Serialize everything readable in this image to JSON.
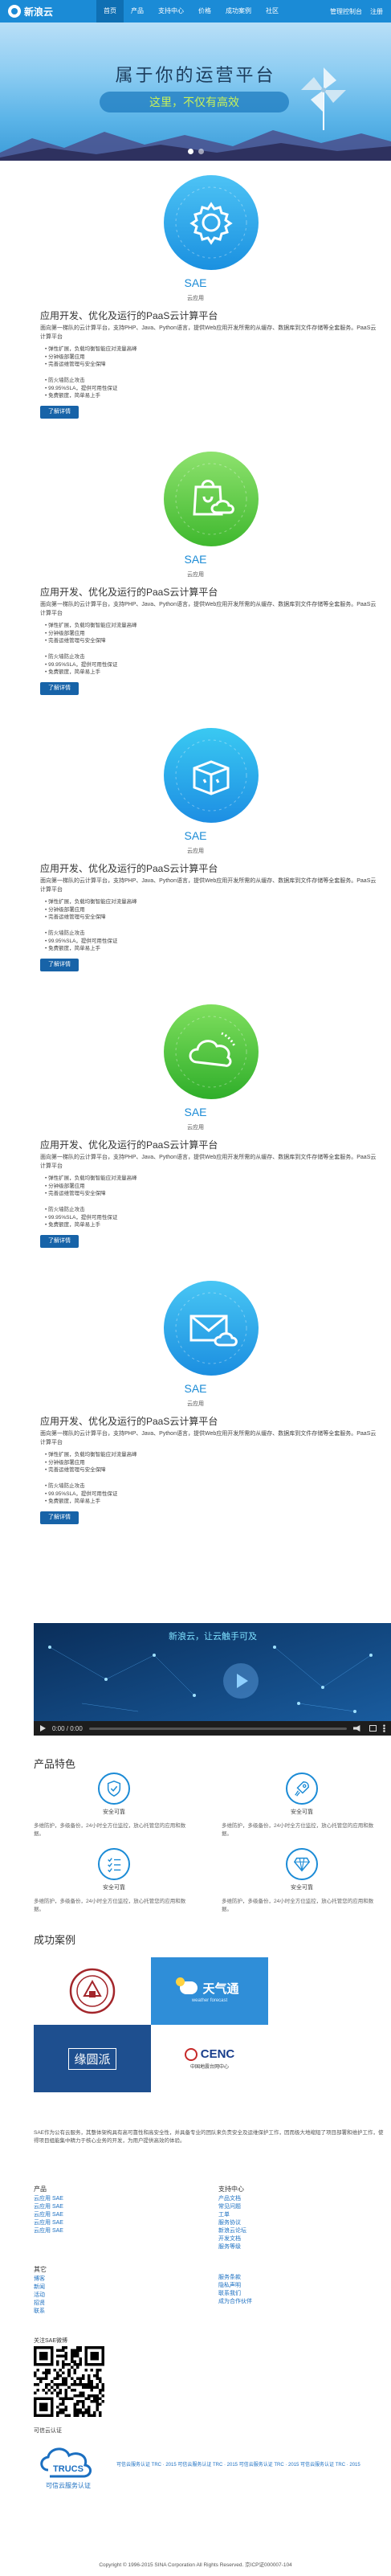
{
  "header": {
    "logo_text": "新浪云",
    "nav": [
      "首页",
      "产品",
      "支持中心",
      "价格",
      "成功案例",
      "社区"
    ],
    "auth": [
      "管理控制台",
      "注册"
    ]
  },
  "banner": {
    "title": "属于你的运营平台",
    "subtitle": "这里，不仅有高效",
    "slide_count": 2,
    "active_slide": 1
  },
  "products": [
    {
      "icon": "gear-icon",
      "color_top": "#4dc3f5",
      "color_bottom": "#1a90e0",
      "name": "SAE",
      "tag": "云应用",
      "title": "应用开发、优化及运行的PaaS云计算平台",
      "desc": "面向第一梯队的云计算平台，支持PHP、Java、Python语言，提供Web应用开发所需的从缓存、数据库到文件存储等全套服务。PaaS云计算平台",
      "list1": [
        "弹性扩展，负载均衡智能应对流量高峰",
        "分钟级部署应用",
        "完善运维管理与安全保障"
      ],
      "list2": [
        "防火墙防止攻击",
        "99.95%SLA，提供可用性保证",
        "免费额度，简单易上手"
      ],
      "button": "了解详情"
    },
    {
      "icon": "bag-cloud-icon",
      "color_top": "#8ee26e",
      "color_bottom": "#3fb82e",
      "name": "SAE",
      "tag": "云应用",
      "title": "应用开发、优化及运行的PaaS云计算平台",
      "desc": "面向第一梯队的云计算平台，支持PHP、Java、Python语言，提供Web应用开发所需的从缓存、数据库到文件存储等全套服务。PaaS云计算平台",
      "list1": [
        "弹性扩展，负载均衡智能应对流量高峰",
        "分钟级部署应用",
        "完善运维管理与安全保障"
      ],
      "list2": [
        "防火墙防止攻击",
        "99.95%SLA，提供可用性保证",
        "免费额度，简单易上手"
      ],
      "button": "了解详情"
    },
    {
      "icon": "box-icon",
      "color_top": "#3ac9f2",
      "color_bottom": "#1d8ee3",
      "name": "SAE",
      "tag": "云应用",
      "title": "应用开发、优化及运行的PaaS云计算平台",
      "desc": "面向第一梯队的云计算平台，支持PHP、Java、Python语言，提供Web应用开发所需的从缓存、数据库到文件存储等全套服务。PaaS云计算平台",
      "list1": [
        "弹性扩展，负载均衡智能应对流量高峰",
        "分钟级部署应用",
        "完善运维管理与安全保障"
      ],
      "list2": [
        "防火墙防止攻击",
        "99.95%SLA，提供可用性保证",
        "免费额度，简单易上手"
      ],
      "button": "了解详情"
    },
    {
      "icon": "cloud-icon",
      "color_top": "#7fdf5e",
      "color_bottom": "#2fae2a",
      "name": "SAE",
      "tag": "云应用",
      "title": "应用开发、优化及运行的PaaS云计算平台",
      "desc": "面向第一梯队的云计算平台，支持PHP、Java、Python语言，提供Web应用开发所需的从缓存、数据库到文件存储等全套服务。PaaS云计算平台",
      "list1": [
        "弹性扩展，负载均衡智能应对流量高峰",
        "分钟级部署应用",
        "完善运维管理与安全保障"
      ],
      "list2": [
        "防火墙防止攻击",
        "99.95%SLA，提供可用性保证",
        "免费额度，简单易上手"
      ],
      "button": "了解详情"
    },
    {
      "icon": "mail-cloud-icon",
      "color_top": "#48c6f4",
      "color_bottom": "#1b8ee0",
      "name": "SAE",
      "tag": "云应用",
      "title": "应用开发、优化及运行的PaaS云计算平台",
      "desc": "面向第一梯队的云计算平台，支持PHP、Java、Python语言，提供Web应用开发所需的从缓存、数据库到文件存储等全套服务。PaaS云计算平台",
      "list1": [
        "弹性扩展，负载均衡智能应对流量高峰",
        "分钟级部署应用",
        "完善运维管理与安全保障"
      ],
      "list2": [
        "防火墙防止攻击",
        "99.95%SLA，提供可用性保证",
        "免费额度，简单易上手"
      ],
      "button": "了解详情"
    }
  ],
  "video": {
    "headline": "新浪云，让云触手可及",
    "time": "0:00 / 0:00"
  },
  "features": {
    "title": "产品特色",
    "items": [
      {
        "icon": "shield-check-icon",
        "label": "安全可靠",
        "desc": "多维防护，多级备份，24小时全方位监控，放心托管您的应用和数据。"
      },
      {
        "icon": "rocket-icon",
        "label": "安全可靠",
        "desc": "多维防护，多级备份，24小时全方位监控，放心托管您的应用和数据。"
      },
      {
        "icon": "checklist-icon",
        "label": "安全可靠",
        "desc": "多维防护，多级备份，24小时全方位监控，放心托管您的应用和数据。"
      },
      {
        "icon": "diamond-icon",
        "label": "安全可靠",
        "desc": "多维防护，多级备份，24小时全方位监控，放心托管您的应用和数据。"
      }
    ]
  },
  "cases": {
    "title": "成功案例",
    "items": [
      {
        "name": "university-seal",
        "text": ""
      },
      {
        "name": "tianqitong-logo",
        "text": "天气通",
        "sub": "weather forecast"
      },
      {
        "name": "yuanquanpai-logo",
        "text": "缘圆派"
      },
      {
        "name": "cenc-logo",
        "text": "CENC",
        "sub": "中国地震台网中心"
      }
    ]
  },
  "footer": {
    "about": "SAE作为公有云服务，其整体架构具有高可靠性和高安全性，并具备专业的团队来负责安全及运维保护工作，因而极大地缩短了项目部署和维护工作，使得项目组能集中精力于核心业务的开发，为用户提供高效的体验。",
    "products_title": "产品",
    "products": [
      "云应用 SAE",
      "云应用 SAE",
      "云应用 SAE",
      "云应用 SAE",
      "云应用 SAE"
    ],
    "support_title": "支持中心",
    "support": [
      "产品文档",
      "常见问题",
      "工单",
      "服务协议",
      "新浪云论坛",
      "开发文档",
      "服务等级"
    ],
    "about_title": "其它",
    "about_links": [
      "博客",
      "新闻",
      "活动",
      "招贤",
      "联系"
    ],
    "more_links": [
      "服务条款",
      "隐私声明",
      "联系我们",
      "成为合作伙伴"
    ],
    "qr_label": "关注SAE微博",
    "cert_label": "可信云认证",
    "trust_text": "可信云服务认证",
    "trust_lines": "可信云服务认证 TRC · 2015    可信云服务认证 TRC · 2015    可信云服务认证 TRC · 2015    可信云服务认证 TRC · 2015",
    "copyright": "Copyright © 1996-2015 SINA Corporation All Rights Reserved. 京ICP证000007-104"
  },
  "colors": {
    "brand": "#1b8bd6",
    "button": "#1763a8"
  }
}
